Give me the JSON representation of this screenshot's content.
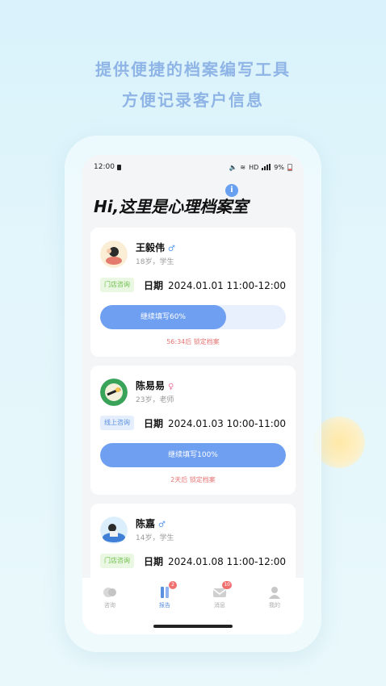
{
  "headline": {
    "line1": "提供便捷的档案编写工具",
    "line2": "方便记录客户信息"
  },
  "status_bar": {
    "time": "12:00",
    "network": "HD",
    "battery": "9%"
  },
  "page_title": "Hi,这里是心理档案室",
  "info_icon": "i",
  "cards": [
    {
      "name": "王毅伟",
      "gender": "male",
      "gender_symbol": "♂",
      "meta": "18岁，学生",
      "tag": "门店咨询",
      "date_label": "日期",
      "date_value": "2024.01.01 11:00-12:00",
      "button_label": "继续填写60%",
      "progress": 0.68,
      "lock_note": "56:34后 锁定档案"
    },
    {
      "name": "陈易易",
      "gender": "female",
      "gender_symbol": "♀",
      "meta": "23岁，老师",
      "tag": "线上咨询",
      "date_label": "日期",
      "date_value": "2024.01.03 10:00-11:00",
      "button_label": "继续填写100%",
      "progress": 1.0,
      "lock_note": "2天后 锁定档案"
    },
    {
      "name": "陈嘉",
      "gender": "male",
      "gender_symbol": "♂",
      "meta": "14岁，学生",
      "tag": "门店咨询",
      "date_label": "日期",
      "date_value": "2024.01.08 11:00-12:00"
    }
  ],
  "tabbar": {
    "items": [
      {
        "label": "咨询",
        "icon": "chat-bubbles-icon"
      },
      {
        "label": "报告",
        "icon": "report-icon",
        "badge": "2"
      },
      {
        "label": "消息",
        "icon": "envelope-icon",
        "badge": "10"
      },
      {
        "label": "我的",
        "icon": "user-icon"
      }
    ]
  },
  "colors": {
    "accent": "#6f9ff0",
    "headline": "#8fb4e6",
    "warning": "#e57373",
    "store_tag": "#6cbf4a",
    "online_tag": "#5b8fe0"
  }
}
